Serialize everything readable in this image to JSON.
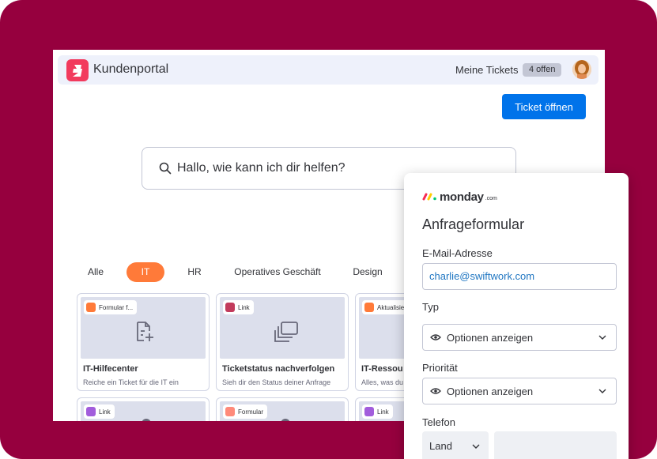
{
  "colors": {
    "background": "#96003e",
    "primary": "#0073ea",
    "active_tab": "#ff7a39",
    "logo": "#f23a5d"
  },
  "header": {
    "title": "Kundenportal",
    "my_tickets_label": "Meine Tickets",
    "open_count_badge": "4 offen"
  },
  "open_ticket_button": "Ticket öffnen",
  "search": {
    "placeholder": "Hallo, wie kann ich dir helfen?"
  },
  "categories": [
    {
      "label": "Alle",
      "active": false
    },
    {
      "label": "IT",
      "active": true
    },
    {
      "label": "HR",
      "active": false
    },
    {
      "label": "Operatives Geschäft",
      "active": false
    },
    {
      "label": "Design",
      "active": false
    }
  ],
  "cards": [
    {
      "pill": "Formular f...",
      "pill_icon": "form-icon",
      "title": "IT-Hilfecenter",
      "description": "Reiche ein Ticket für die IT ein",
      "icon": "document-add-icon"
    },
    {
      "pill": "Link",
      "pill_icon": "link-icon",
      "title": "Ticketstatus nachverfolgen",
      "description": "Sieh dir den Status deiner Anfrage",
      "icon": "copy-stack-icon"
    },
    {
      "pill": "Aktualisier",
      "pill_icon": "person-icon",
      "title": "IT-Ressou",
      "description": "Alles, was du",
      "icon": ""
    }
  ],
  "cards_row2": [
    {
      "pill": "Link",
      "pill_icon": "person-icon"
    },
    {
      "pill": "Formular",
      "pill_icon": "person-icon"
    },
    {
      "pill": "Link",
      "pill_icon": "person-icon"
    }
  ],
  "form": {
    "brand": "monday",
    "brand_suffix": ".com",
    "title": "Anfrageformular",
    "email_label": "E-Mail-Adresse",
    "email_value": "charlie@swiftwork.com",
    "type_label": "Typ",
    "type_select": "Optionen anzeigen",
    "priority_label": "Priorität",
    "priority_select": "Optionen anzeigen",
    "phone_label": "Telefon",
    "country_select": "Land",
    "phone_value": ""
  }
}
